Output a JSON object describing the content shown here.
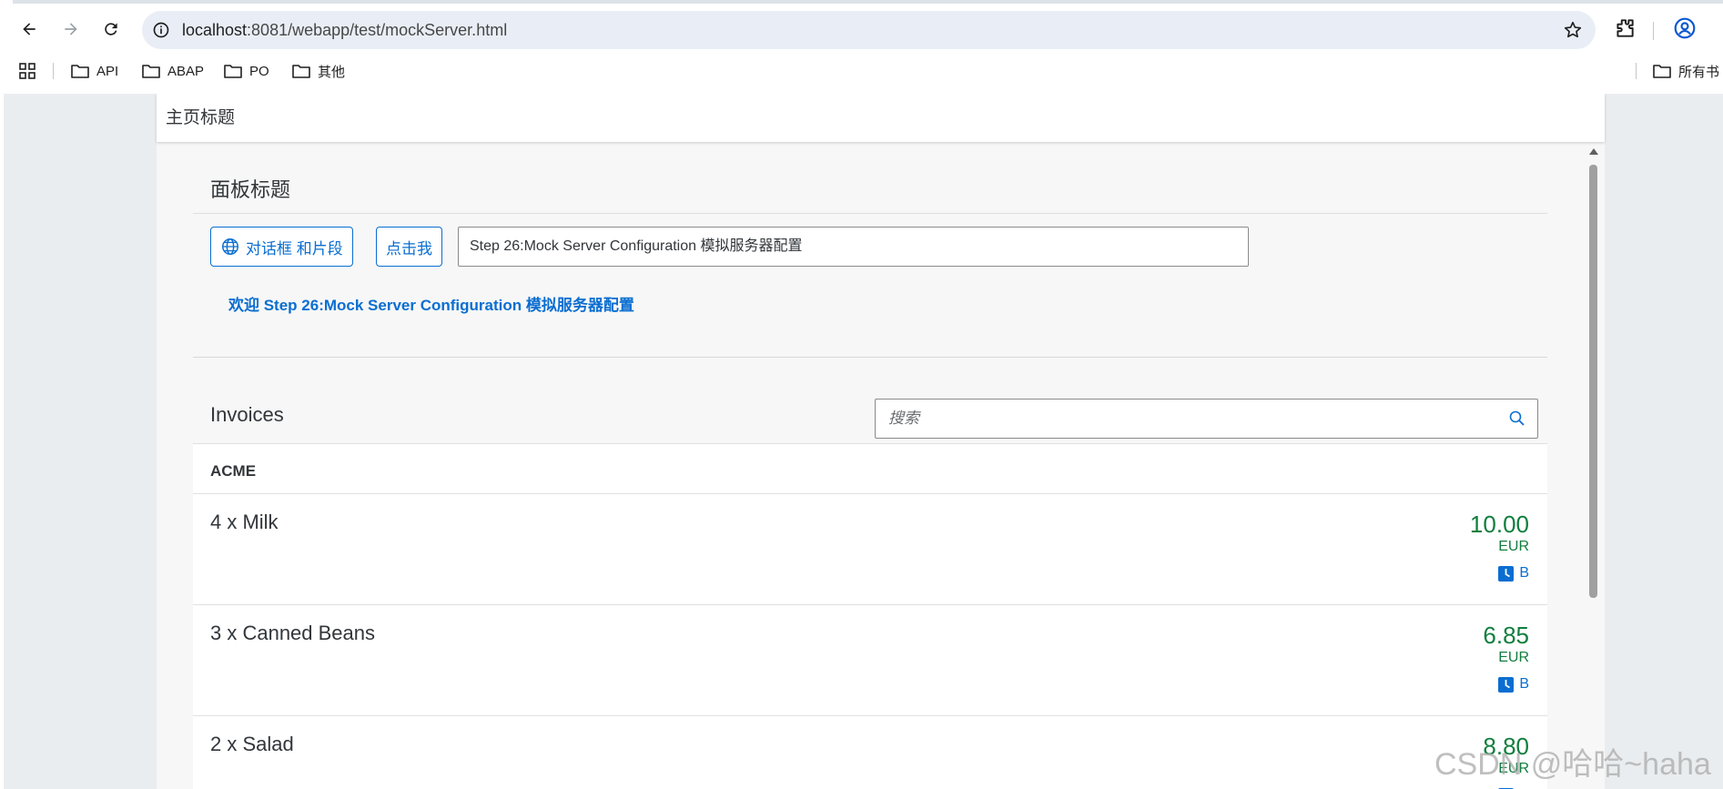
{
  "browser": {
    "url_host": "localhost",
    "url_path": ":8081/webapp/test/mockServer.html",
    "bookmarks": [
      {
        "label": "API"
      },
      {
        "label": "ABAP"
      },
      {
        "label": "PO"
      },
      {
        "label": "其他"
      }
    ],
    "all_bookmarks_label": "所有书"
  },
  "shell": {
    "title": "主页标题"
  },
  "panel": {
    "title": "面板标题",
    "dialog_button_label": "对话框 和片段",
    "click_button_label": "点击我",
    "input_value": "Step 26:Mock Server Configuration 模拟服务器配置",
    "welcome_text": "欢迎 Step 26:Mock Server Configuration 模拟服务器配置"
  },
  "invoices": {
    "title": "Invoices",
    "search_placeholder": "搜索",
    "group_header": "ACME",
    "items": [
      {
        "name": "4 x Milk",
        "amount": "10.00",
        "currency": "EUR",
        "status": "B"
      },
      {
        "name": "3 x Canned Beans",
        "amount": "6.85",
        "currency": "EUR",
        "status": "B"
      },
      {
        "name": "2 x Salad",
        "amount": "8.80",
        "currency": "EUR",
        "status": "B"
      }
    ]
  },
  "colors": {
    "accent": "#0a6ed1",
    "positive": "#107e3e"
  },
  "watermark": "CSDN @哈哈~haha"
}
